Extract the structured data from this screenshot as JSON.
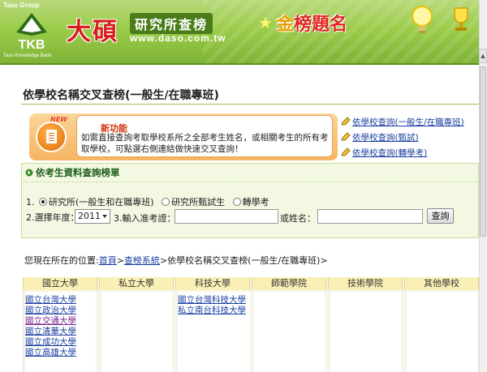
{
  "header": {
    "group_label": "Taso Group",
    "logo_text": "TKB",
    "logo_sub": "Taso Knowledge Bank",
    "brand_name": "大碩",
    "brand_tag": "研究所查榜",
    "brand_url": "www.daso.com.tw",
    "title_gold": "金",
    "title_rest": "榜題名"
  },
  "page": {
    "title": "依學校名稱交叉查榜(一般生/在職專班)"
  },
  "notice": {
    "badge": "NEW",
    "heading": "新功能",
    "body": "如需直接查詢考取學校系所之全部考生姓名，或相關考生的所有考取學校，可點選右側連結做快速交叉查詢！"
  },
  "right_links": [
    {
      "label": "依學校查詢(一般生/在職專班)"
    },
    {
      "label": "依學校查詢(甄試)"
    },
    {
      "label": "依學校查詢(轉學考)"
    }
  ],
  "search": {
    "heading": "依考生資料查詢榜單",
    "step1_label": "1.",
    "options": [
      {
        "label": "研究所(一般生和在職專班)",
        "selected": true
      },
      {
        "label": "研究所甄試生",
        "selected": false
      },
      {
        "label": "轉學考",
        "selected": false
      }
    ],
    "year_label": "2.選擇年度：",
    "year_value": "2011",
    "admission_label": "3.輸入准考證：",
    "admission_value": "",
    "or_name_label": "或姓名：",
    "name_value": "",
    "submit_label": "查詢"
  },
  "breadcrumb": {
    "prefix": "您現在所在的位置:",
    "home": "首頁",
    "sep1": ">",
    "system": "查榜系統",
    "sep2": ">",
    "current": "依學校名稱交叉查榜(一般生/在職專班)>"
  },
  "categories": [
    {
      "label": "國立大學",
      "schools": [
        "國立台灣大學",
        "國立政治大學",
        "國立交通大學",
        "國立清華大學",
        "國立成功大學",
        "國立高雄大學"
      ]
    },
    {
      "label": "私立大學",
      "schools": []
    },
    {
      "label": "科技大學",
      "schools": [
        "國立台灣科技大學",
        "私立南台科技大學"
      ]
    },
    {
      "label": "師範學院",
      "schools": []
    },
    {
      "label": "技術學院",
      "schools": []
    },
    {
      "label": "其他學校",
      "schools": []
    }
  ],
  "colors": {
    "banner_green": "#9ccc4a",
    "brand_red": "#d81b1b",
    "link_blue": "#1a3fa0",
    "visited_purple": "#7a2090",
    "notice_orange": "#f6b461",
    "search_bg": "#f3f8e2",
    "table_header": "#faf0b6"
  }
}
